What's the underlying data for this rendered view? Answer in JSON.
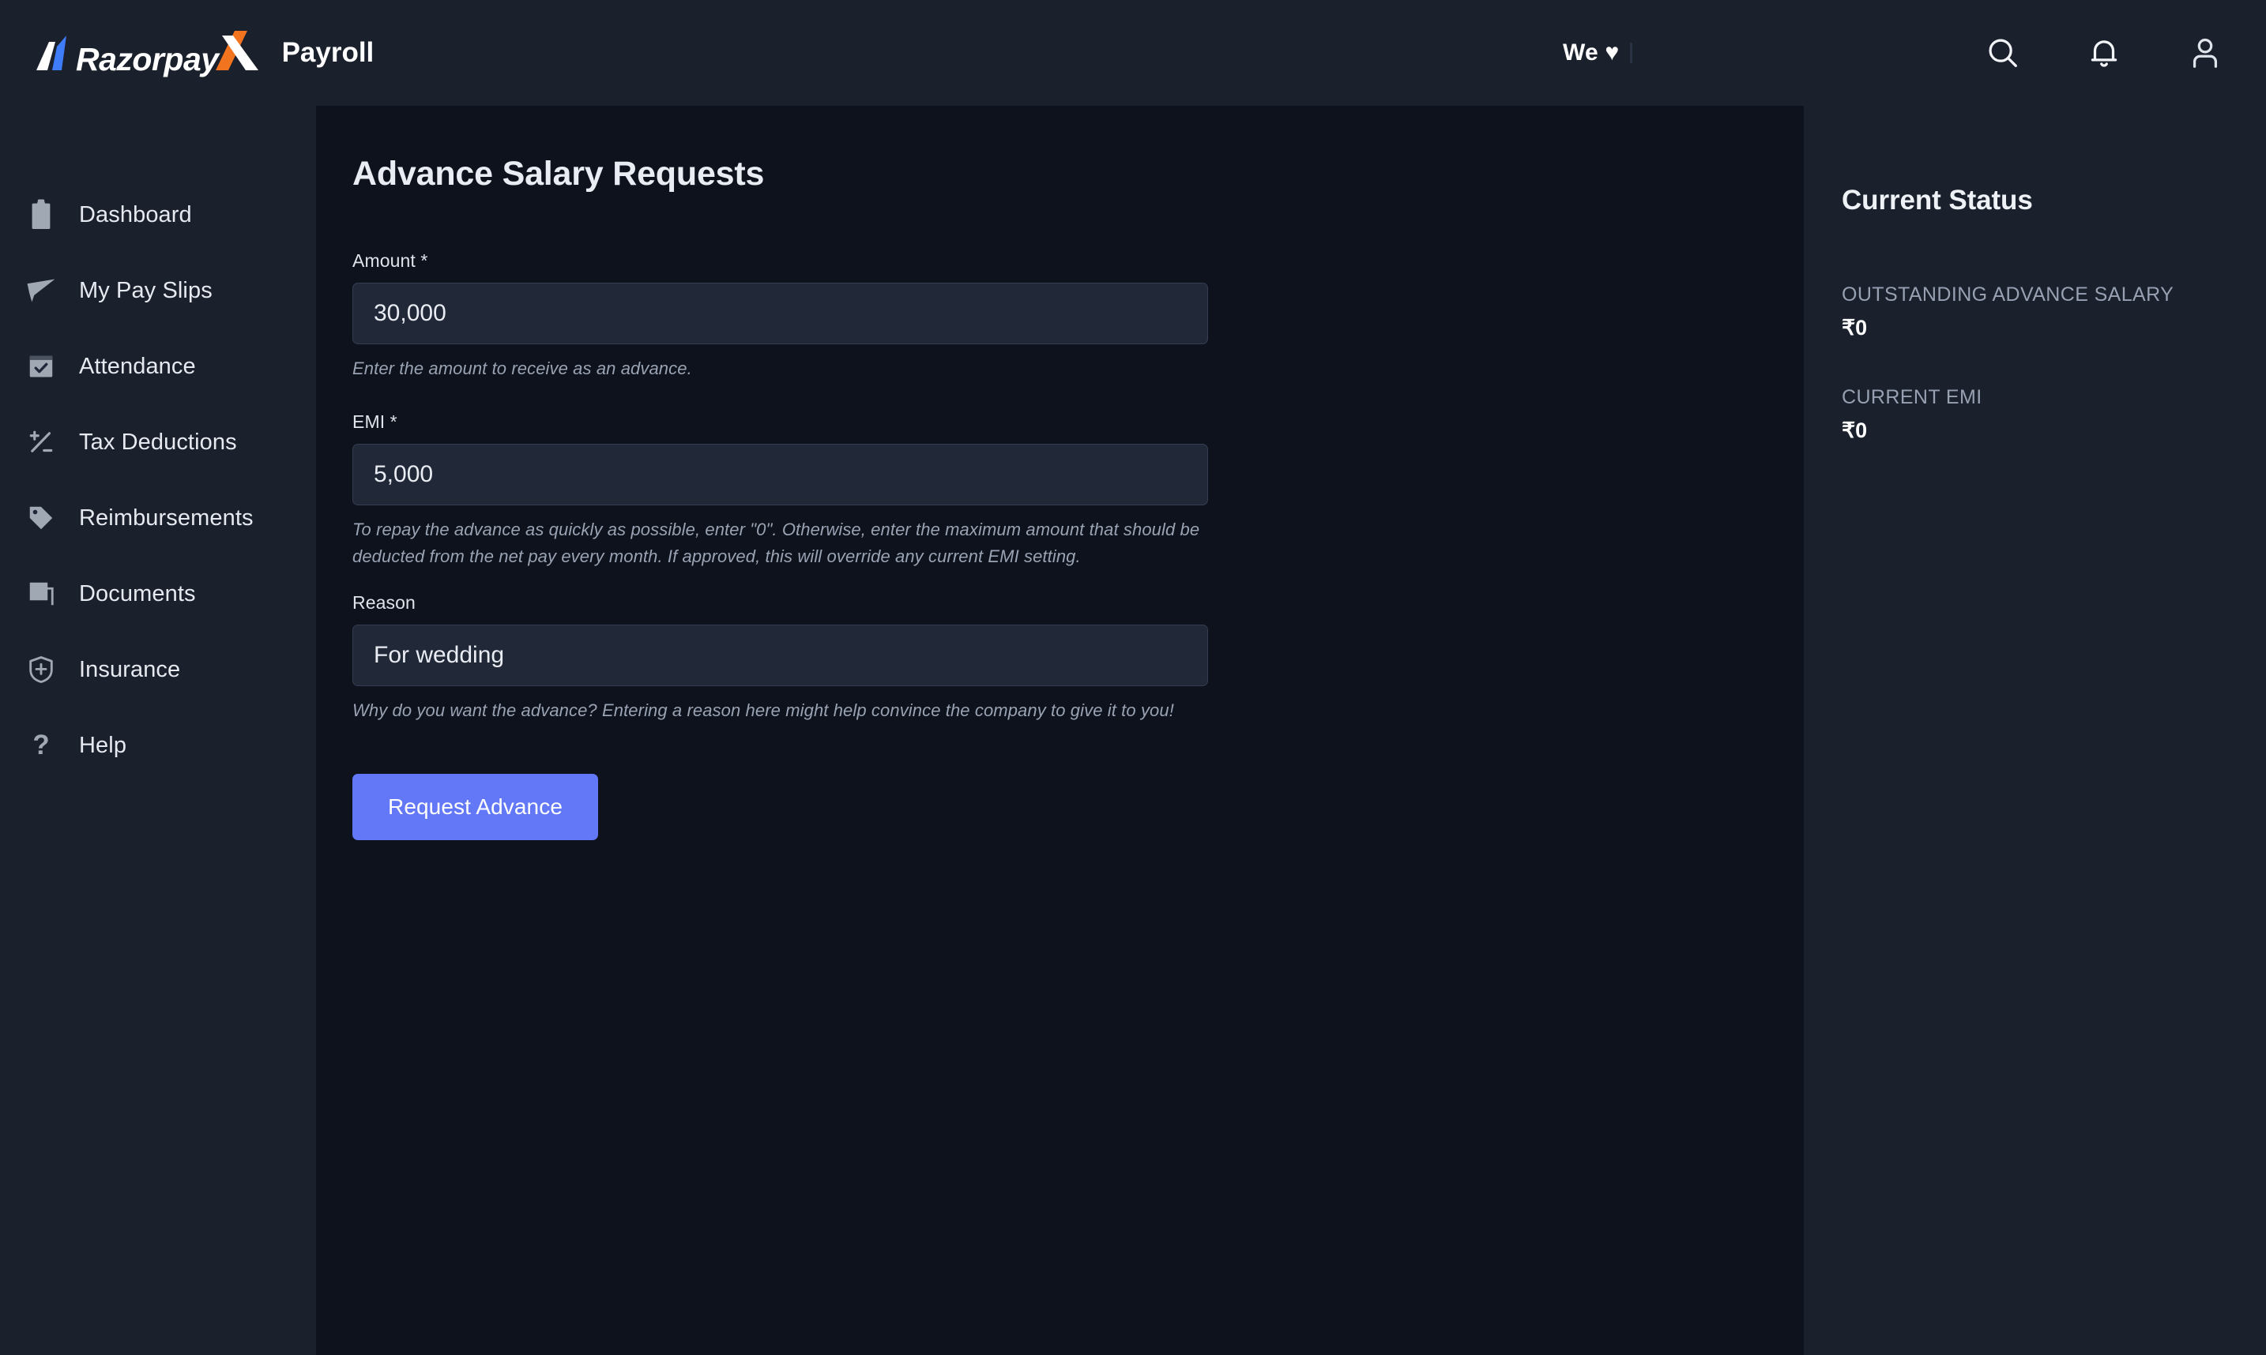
{
  "header": {
    "brand_word": "Razorpay",
    "brand_x": "X",
    "brand_product": "Payroll",
    "we_love": "We ♥",
    "icons": {
      "search": "search-icon",
      "notifications": "bell-icon",
      "account": "user-icon"
    }
  },
  "sidebar": {
    "items": [
      {
        "label": "Dashboard",
        "icon": "clipboard-icon"
      },
      {
        "label": "My Pay Slips",
        "icon": "paper-plane-icon"
      },
      {
        "label": "Attendance",
        "icon": "calendar-check-icon"
      },
      {
        "label": "Tax Deductions",
        "icon": "plus-minus-icon"
      },
      {
        "label": "Reimbursements",
        "icon": "tag-icon"
      },
      {
        "label": "Documents",
        "icon": "documents-icon"
      },
      {
        "label": "Insurance",
        "icon": "shield-plus-icon"
      },
      {
        "label": "Help",
        "icon": "question-mark-icon"
      }
    ]
  },
  "main": {
    "page_title": "Advance Salary Requests",
    "fields": {
      "amount": {
        "label": "Amount *",
        "value": "30,000",
        "placeholder": "",
        "help": "Enter the amount to receive as an advance."
      },
      "emi": {
        "label": "EMI *",
        "value": "5,000",
        "placeholder": "",
        "help": "To repay the advance as quickly as possible, enter \"0\". Otherwise, enter the maximum amount that should be deducted from the net pay every month. If approved, this will override any current EMI setting."
      },
      "reason": {
        "label": "Reason",
        "value": "For wedding",
        "placeholder": "",
        "help": "Why do you want the advance? Entering a reason here might help convince the company to give it to you!"
      }
    },
    "submit_label": "Request Advance"
  },
  "status": {
    "title": "Current Status",
    "items": [
      {
        "label": "OUTSTANDING ADVANCE SALARY",
        "value": "₹0"
      },
      {
        "label": "CURRENT EMI",
        "value": "₹0"
      }
    ]
  },
  "colors": {
    "accent": "#6278f7",
    "panel": "#1a202c",
    "content": "#0d121c",
    "input_bg": "#212838",
    "brand_blue": "#3f7cf7",
    "brand_orange": "#f2741f"
  }
}
